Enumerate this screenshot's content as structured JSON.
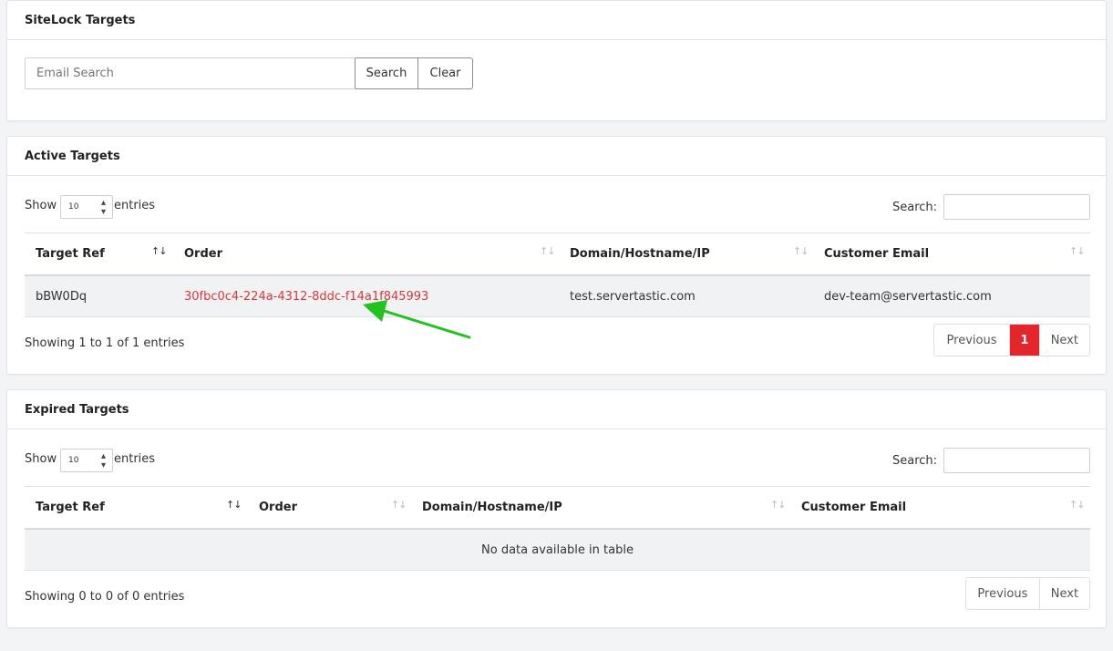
{
  "sitelock": {
    "title": "SiteLock Targets",
    "email_placeholder": "Email Search",
    "search_label": "Search",
    "clear_label": "Clear"
  },
  "active": {
    "title": "Active Targets",
    "show_label": "Show",
    "page_size": "10",
    "entries_label": "entries",
    "search_label": "Search:",
    "columns": [
      "Target Ref",
      "Order",
      "Domain/Hostname/IP",
      "Customer Email"
    ],
    "rows": [
      {
        "target_ref": "bBW0Dq",
        "order": "30fbc0c4-224a-4312-8ddc-f14a1f845993",
        "domain": "test.servertastic.com",
        "email": "dev-team@servertastic.com"
      }
    ],
    "info": "Showing 1 to 1 of 1 entries",
    "pagination": {
      "previous": "Previous",
      "current": "1",
      "next": "Next"
    }
  },
  "expired": {
    "title": "Expired Targets",
    "show_label": "Show",
    "page_size": "10",
    "entries_label": "entries",
    "search_label": "Search:",
    "columns": [
      "Target Ref",
      "Order",
      "Domain/Hostname/IP",
      "Customer Email"
    ],
    "empty_message": "No data available in table",
    "info": "Showing 0 to 0 of 0 entries",
    "pagination": {
      "previous": "Previous",
      "next": "Next"
    }
  },
  "colors": {
    "accent": "#e4252a",
    "link": "#d9383a",
    "annotation_arrow": "#22c21f"
  },
  "icons": {
    "sort": "sort-arrows-icon",
    "select": "select-toggle-icon",
    "annotation": "green-arrow-annotation"
  }
}
